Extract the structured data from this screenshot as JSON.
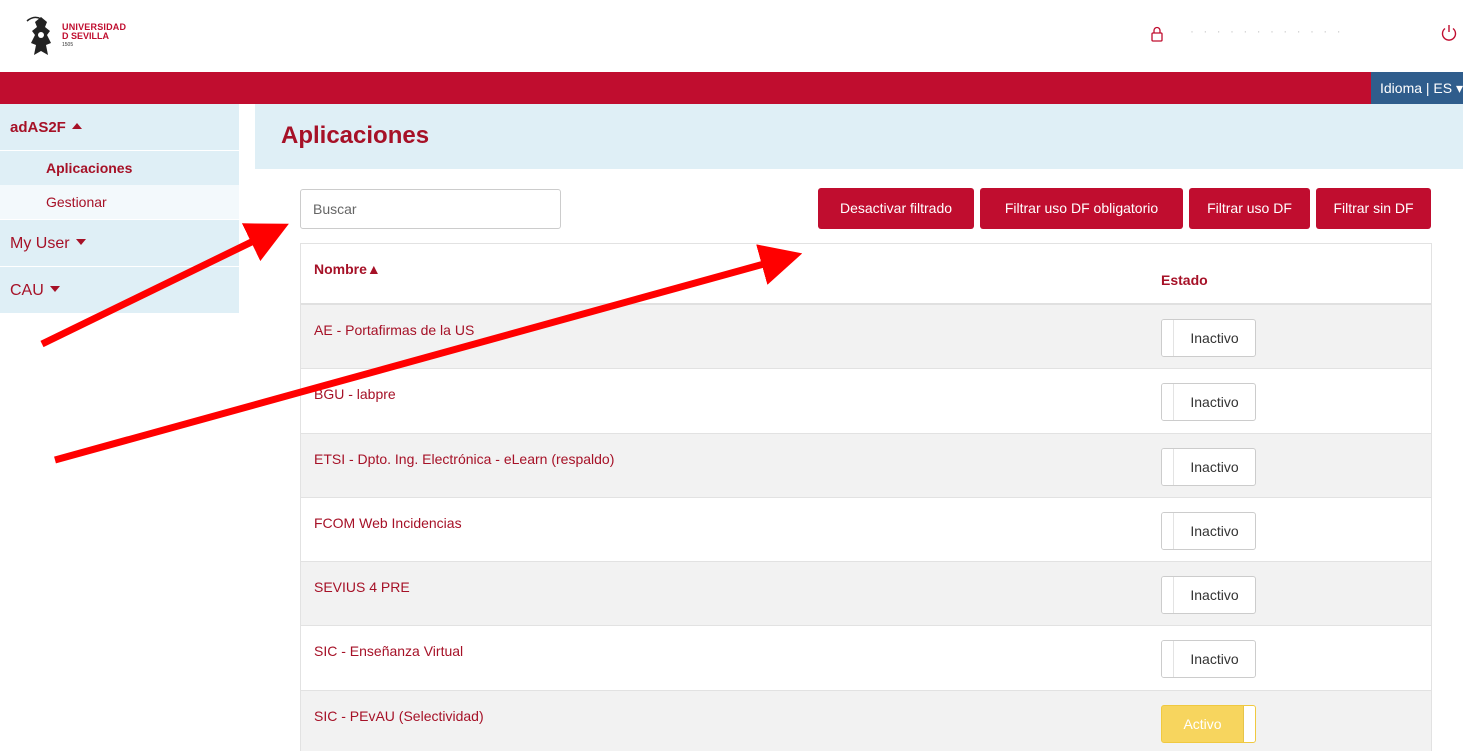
{
  "header": {
    "logo": {
      "line1": "UNIVERSIDAD",
      "line2": "D SEVILLA",
      "line3": "1505"
    },
    "user_icon": "lock-icon",
    "username": "· · ·  · · ·  · · · · · ·",
    "power_icon": "power-icon",
    "language": "Idioma | ES"
  },
  "sidebar": {
    "section_title": "adAS2F",
    "items": [
      {
        "label": "Aplicaciones",
        "active": true
      },
      {
        "label": "Gestionar",
        "active": false
      }
    ],
    "my_user": "My User",
    "cau": "CAU"
  },
  "main": {
    "title": "Aplicaciones",
    "search_placeholder": "Buscar",
    "buttons": [
      "Desactivar filtrado",
      "Filtrar uso DF obligatorio",
      "Filtrar uso DF",
      "Filtrar sin DF"
    ],
    "table": {
      "col_nombre": "Nombre▲",
      "col_estado": "Estado",
      "rows": [
        {
          "name": "AE - Portafirmas de la US",
          "status": "Inactivo"
        },
        {
          "name": "BGU - labpre",
          "status": "Inactivo"
        },
        {
          "name": "ETSI - Dpto. Ing. Electrónica - eLearn (respaldo)",
          "status": "Inactivo"
        },
        {
          "name": "FCOM Web Incidencias",
          "status": "Inactivo"
        },
        {
          "name": "SEVIUS 4 PRE",
          "status": "Inactivo"
        },
        {
          "name": "SIC - Enseñanza Virtual",
          "status": "Inactivo"
        },
        {
          "name": "SIC - PEvAU (Selectividad)",
          "status": "Activo"
        }
      ]
    }
  },
  "colors": {
    "brand_red": "#c00d2f",
    "light_blue": "#dfeff6",
    "lang_blue": "#2f5d8c",
    "active_yellow": "#f7d55e",
    "arrow_red": "#ff0000"
  }
}
